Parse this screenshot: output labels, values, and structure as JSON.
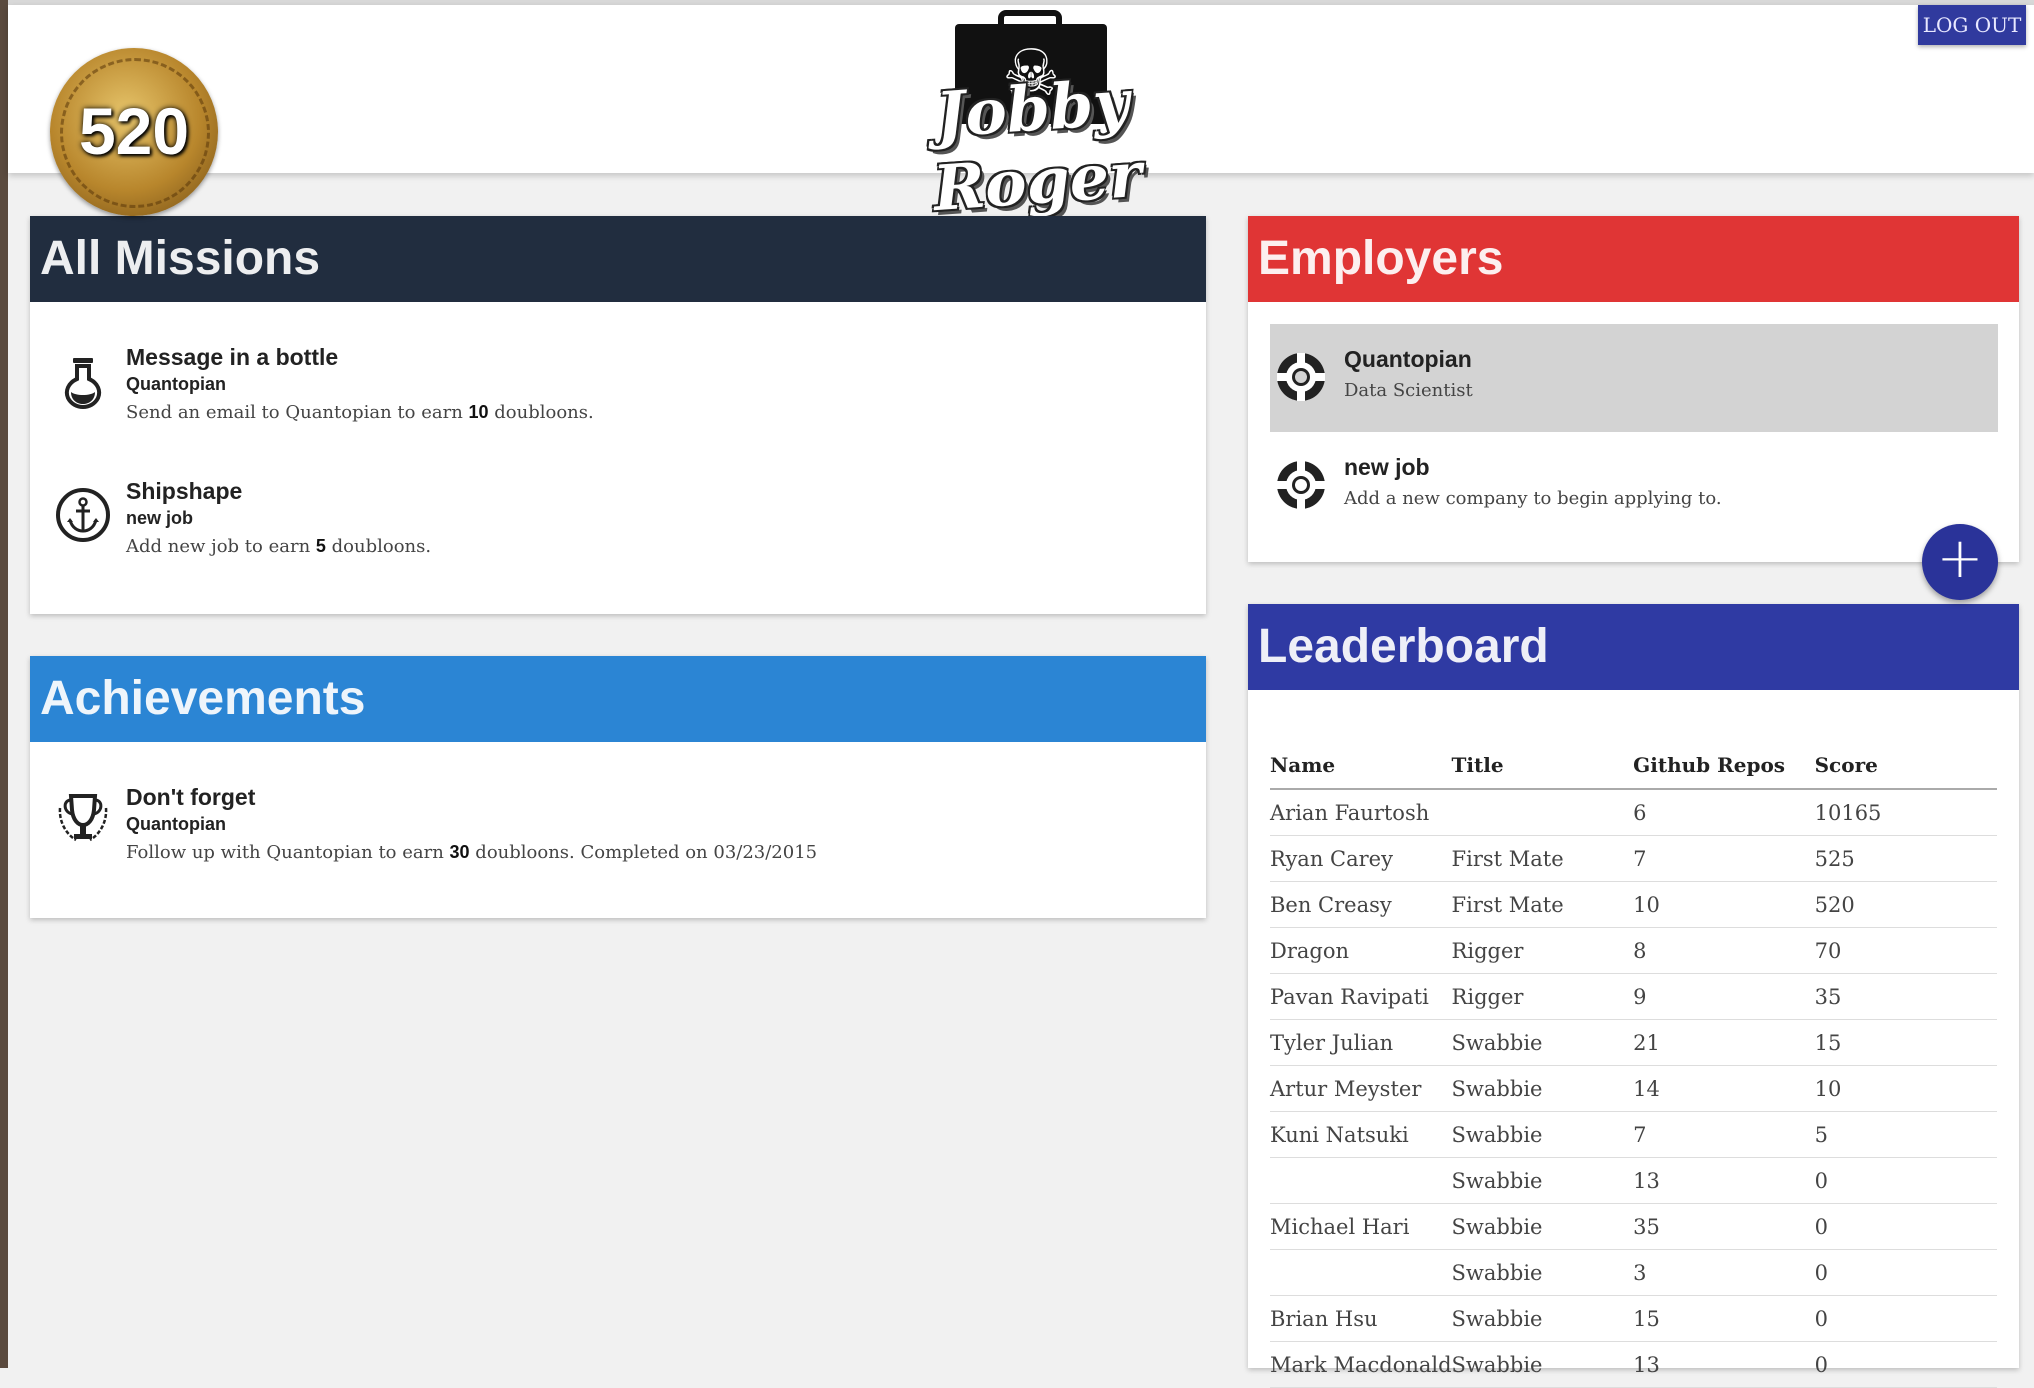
{
  "header": {
    "score": "520",
    "logo_text": "Jobby Roger",
    "logout_label": "LOG OUT"
  },
  "colors": {
    "missions_header": "#212d3f",
    "achievements_header": "#2b85d4",
    "employers_header": "#e03535",
    "leaderboard_header": "#2f3aa3",
    "fab": "#2a3399"
  },
  "missions": {
    "title": "All Missions",
    "items": [
      {
        "icon": "potion-flask-icon",
        "title": "Message in a bottle",
        "company": "Quantopian",
        "desc_pre": "Send an email to Quantopian to earn ",
        "points": "10",
        "desc_post": " doubloons."
      },
      {
        "icon": "anchor-icon",
        "title": "Shipshape",
        "company": "new job",
        "desc_pre": "Add new job to earn ",
        "points": "5",
        "desc_post": " doubloons."
      }
    ]
  },
  "achievements": {
    "title": "Achievements",
    "items": [
      {
        "icon": "trophy-icon",
        "title": "Don't forget",
        "company": "Quantopian",
        "desc_pre": "Follow up with Quantopian to earn ",
        "points": "30",
        "desc_post": " doubloons. Completed on 03/23/2015"
      }
    ]
  },
  "employers": {
    "title": "Employers",
    "items": [
      {
        "icon": "life-ring-icon",
        "name": "Quantopian",
        "role": "Data Scientist",
        "selected": true
      },
      {
        "icon": "life-ring-icon",
        "name": "new job",
        "role": "Add a new company to begin applying to.",
        "selected": false
      }
    ],
    "add_button": "+"
  },
  "leaderboard": {
    "title": "Leaderboard",
    "columns": [
      "Name",
      "Title",
      "Github Repos",
      "Score"
    ],
    "rows": [
      [
        "Arian Faurtosh",
        "",
        "6",
        "10165"
      ],
      [
        "Ryan Carey",
        "First Mate",
        "7",
        "525"
      ],
      [
        "Ben Creasy",
        "First Mate",
        "10",
        "520"
      ],
      [
        "Dragon",
        "Rigger",
        "8",
        "70"
      ],
      [
        "Pavan Ravipati",
        "Rigger",
        "9",
        "35"
      ],
      [
        "Tyler Julian",
        "Swabbie",
        "21",
        "15"
      ],
      [
        "Artur Meyster",
        "Swabbie",
        "14",
        "10"
      ],
      [
        "Kuni Natsuki",
        "Swabbie",
        "7",
        "5"
      ],
      [
        "",
        "Swabbie",
        "13",
        "0"
      ],
      [
        "Michael Hari",
        "Swabbie",
        "35",
        "0"
      ],
      [
        "",
        "Swabbie",
        "3",
        "0"
      ],
      [
        "Brian Hsu",
        "Swabbie",
        "15",
        "0"
      ],
      [
        "Mark Macdonald",
        "Swabbie",
        "13",
        "0"
      ]
    ]
  }
}
